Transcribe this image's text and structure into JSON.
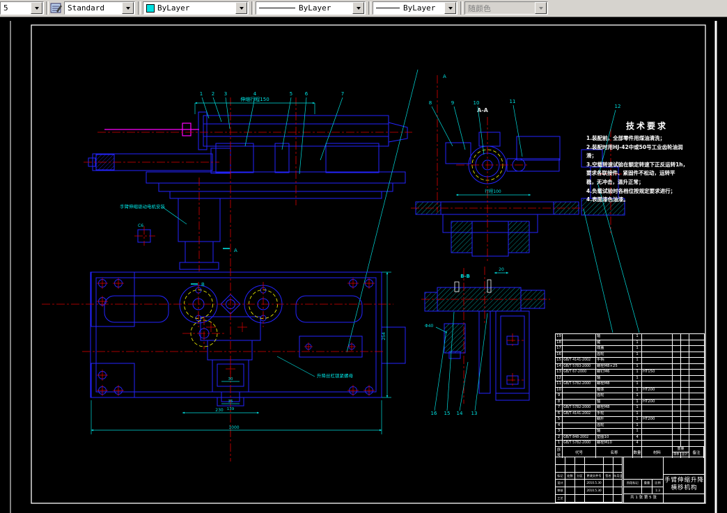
{
  "toolbar": {
    "dim_combo": "5",
    "text_style": "Standard",
    "color": "ByLayer",
    "linetype": "ByLayer",
    "lineweight": "ByLayer",
    "plot_style": "随颜色",
    "color_swatch": "#00e0e0"
  },
  "tech_req": {
    "title": "技术要求",
    "lines": [
      "1.装配前，全部零件用煤油清洗；",
      "2.装配时用HJ-42中或50号工业齿轮油润",
      "滑；",
      "3.空载转速试验在额定转速下正反运转1h，",
      "要求各联接件、紧固件不松动，运转平",
      "稳，无冲击，温升正常；",
      "4.负载试验时各档位按规定要求进行；",
      "4.表面漆色油漆。"
    ]
  },
  "drawing": {
    "labels": {
      "aa": "A-A",
      "bb": "B-B",
      "a_mark": "A",
      "b_mark": "B",
      "detail": "C6"
    },
    "dims": {
      "stroke_travel": "伸缩行程150",
      "travel": "行程100",
      "d30": "30",
      "d35": "35",
      "d139": "139",
      "d230": "230",
      "d1000": "1000",
      "d254": "254",
      "phi40": "Φ40",
      "d20": "20"
    },
    "callouts": {
      "top": [
        "1",
        "2",
        "3",
        "4",
        "5",
        "6",
        "7"
      ],
      "aa": [
        "8",
        "9",
        "10",
        "11",
        "12"
      ],
      "bb": [
        "16",
        "15",
        "14",
        "13"
      ]
    },
    "annotations": [
      "手臂伸缩驱动电机安装",
      "升降丝杠锁紧螺母"
    ]
  },
  "bom": {
    "headers": {
      "no": "序号",
      "code": "代号",
      "name": "名称",
      "qty": "数量",
      "material": "材料",
      "weight": "重量",
      "unit": "单件",
      "total": "总计",
      "note": "备注"
    },
    "rows": [
      [
        "19",
        "",
        "轴",
        "1",
        "",
        "",
        "",
        ""
      ],
      [
        "18",
        "",
        "键",
        "1",
        "",
        "",
        "",
        ""
      ],
      [
        "17",
        "",
        "端盖",
        "1",
        "",
        "",
        "",
        ""
      ],
      [
        "16",
        "",
        "齿轮",
        "1",
        "",
        "",
        "",
        ""
      ],
      [
        "15",
        "GB/T 4141-2002",
        "手柄",
        "1",
        "",
        "",
        "",
        ""
      ],
      [
        "14",
        "GB/T 5783-2000",
        "螺栓M8×25",
        "1",
        "",
        "",
        "",
        ""
      ],
      [
        "13",
        "GB/T 67-2000",
        "螺钉M6",
        "1",
        "HT150",
        "",
        "",
        ""
      ],
      [
        "12",
        "",
        "轴",
        "1",
        "",
        "",
        "",
        ""
      ],
      [
        "11",
        "GB/T 5782-2000",
        "螺栓M8",
        "1",
        "",
        "",
        "",
        ""
      ],
      [
        "10",
        "",
        "箱体",
        "1",
        "HT200",
        "",
        "",
        ""
      ],
      [
        "9",
        "",
        "齿轮",
        "1",
        "",
        "",
        "",
        ""
      ],
      [
        "8",
        "",
        "轴",
        "1",
        "HT200",
        "",
        "",
        ""
      ],
      [
        "7",
        "GB/T 5782-2000",
        "螺栓M8",
        "1",
        "",
        "",
        "",
        ""
      ],
      [
        "6",
        "GB/T 4141-2002",
        "手轮",
        "1",
        "",
        "",
        "",
        ""
      ],
      [
        "5",
        "",
        "蜗杆",
        "1",
        "HT200",
        "",
        "",
        ""
      ],
      [
        "4",
        "",
        "齿轮",
        "1",
        "",
        "",
        "",
        ""
      ],
      [
        "3",
        "",
        "轴",
        "1",
        "",
        "",
        "",
        ""
      ],
      [
        "2",
        "GB/T 848-2002",
        "垫圈10",
        "4",
        "",
        "",
        "",
        ""
      ],
      [
        "1",
        "GB/T 5782-2000",
        "螺栓M10",
        "4",
        "",
        "",
        "",
        ""
      ]
    ]
  },
  "title_block": {
    "sign_headers": [
      "标记",
      "处数",
      "分区",
      "更改文件号",
      "签名",
      "年月日"
    ],
    "rows": [
      {
        "label": "设计",
        "date": "2010.5.30"
      },
      {
        "label": "审核",
        "date": "2010.5.30"
      },
      {
        "label": "工艺",
        "date": ""
      }
    ],
    "stage_label": "阶段标记",
    "weight_label": "重量",
    "scale_label": "比例",
    "scale": "1:3",
    "sheet_info": "共 1 张  第 5 张",
    "title_line1": "手臂伸缩升降",
    "title_line2": "横移机构"
  }
}
